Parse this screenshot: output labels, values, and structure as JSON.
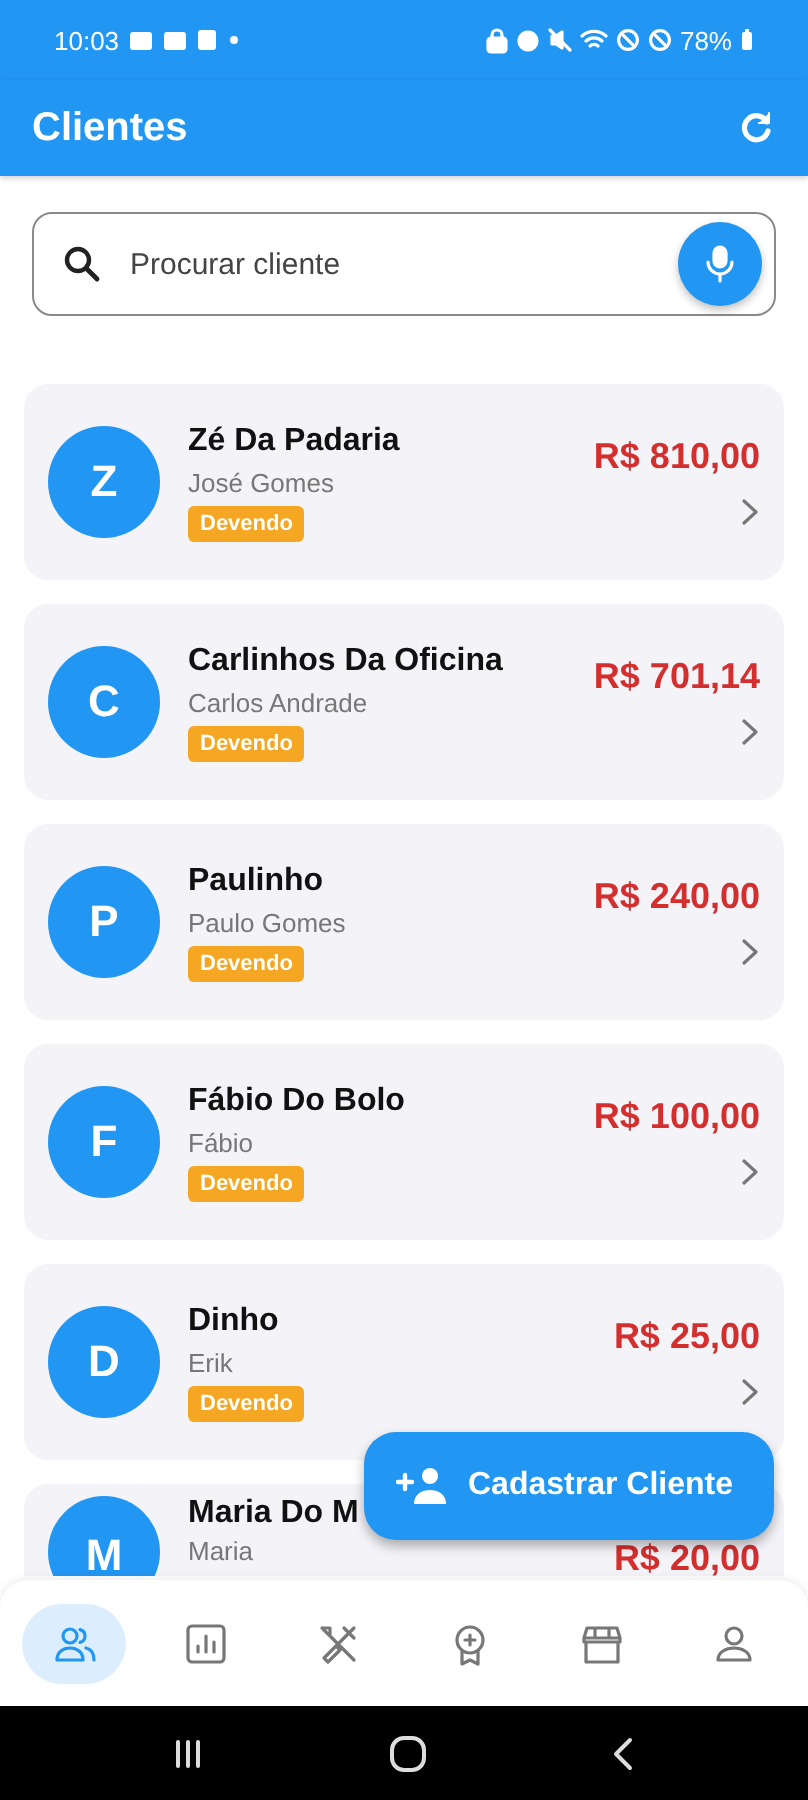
{
  "status_bar": {
    "time": "10:03",
    "battery": "78%"
  },
  "app_bar": {
    "title": "Clientes"
  },
  "search": {
    "placeholder": "Procurar cliente"
  },
  "clients": [
    {
      "initial": "Z",
      "name": "Zé Da Padaria",
      "contact": "José Gomes",
      "status": "Devendo",
      "amount": "R$ 810,00"
    },
    {
      "initial": "C",
      "name": "Carlinhos Da Oficina",
      "contact": "Carlos Andrade",
      "status": "Devendo",
      "amount": "R$ 701,14"
    },
    {
      "initial": "P",
      "name": "Paulinho",
      "contact": "Paulo Gomes",
      "status": "Devendo",
      "amount": "R$ 240,00"
    },
    {
      "initial": "F",
      "name": "Fábio Do Bolo",
      "contact": "Fábio",
      "status": "Devendo",
      "amount": "R$ 100,00"
    },
    {
      "initial": "D",
      "name": "Dinho",
      "contact": "Erik",
      "status": "Devendo",
      "amount": "R$ 25,00"
    },
    {
      "initial": "M",
      "name": "Maria Do M",
      "contact": "Maria",
      "amount": "R$ 20,00"
    }
  ],
  "fab": {
    "label": "Cadastrar Cliente"
  },
  "nav": [
    {
      "kind": "clients",
      "selected": true
    },
    {
      "kind": "reports",
      "selected": false
    },
    {
      "kind": "tools",
      "selected": false
    },
    {
      "kind": "award",
      "selected": false
    },
    {
      "kind": "store",
      "selected": false
    },
    {
      "kind": "profile",
      "selected": false
    }
  ]
}
